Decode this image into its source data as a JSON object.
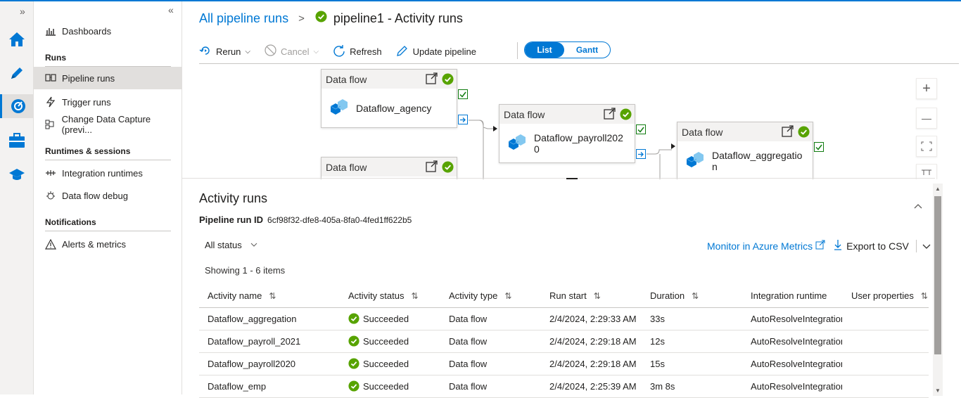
{
  "rail": {
    "expand": "»"
  },
  "nav": {
    "collapse": "«",
    "dashboards": "Dashboards",
    "runs_header": "Runs",
    "pipeline_runs": "Pipeline runs",
    "trigger_runs": "Trigger runs",
    "cdc": "Change Data Capture (previ...",
    "runtimes_header": "Runtimes & sessions",
    "integration_runtimes": "Integration runtimes",
    "dataflow_debug": "Data flow debug",
    "notifications_header": "Notifications",
    "alerts": "Alerts & metrics"
  },
  "breadcrumb": {
    "link": "All pipeline runs",
    "sep": ">",
    "title": "pipeline1 - Activity runs"
  },
  "toolbar": {
    "rerun": "Rerun",
    "cancel": "Cancel",
    "refresh": "Refresh",
    "update": "Update pipeline",
    "list": "List",
    "gantt": "Gantt"
  },
  "canvas": {
    "nodes": [
      {
        "type": "Data flow",
        "name": "Dataflow_agency"
      },
      {
        "type": "Data flow",
        "name": "Dataflow_payroll2020"
      },
      {
        "type": "Data flow",
        "name": "Dataflow_aggregation"
      },
      {
        "type": "Data flow",
        "name": ""
      }
    ],
    "zoom_in": "+",
    "zoom_out": "—"
  },
  "activity": {
    "title": "Activity runs",
    "run_id_label": "Pipeline run ID",
    "run_id": "6cf98f32-dfe8-405a-8fa0-4fed1ff622b5",
    "filter": "All status",
    "monitor": "Monitor in Azure Metrics",
    "export": "Export to CSV",
    "showing": "Showing 1 - 6 items",
    "columns": [
      "Activity name",
      "Activity status",
      "Activity type",
      "Run start",
      "Duration",
      "Integration runtime",
      "User properties"
    ],
    "rows": [
      [
        "Dataflow_aggregation",
        "Succeeded",
        "Data flow",
        "2/4/2024, 2:29:33 AM",
        "33s",
        "AutoResolveIntegrationRuntime"
      ],
      [
        "Dataflow_payroll_2021",
        "Succeeded",
        "Data flow",
        "2/4/2024, 2:29:18 AM",
        "12s",
        "AutoResolveIntegrationRuntime"
      ],
      [
        "Dataflow_payroll2020",
        "Succeeded",
        "Data flow",
        "2/4/2024, 2:29:18 AM",
        "15s",
        "AutoResolveIntegrationRuntime"
      ],
      [
        "Dataflow_emp",
        "Succeeded",
        "Data flow",
        "2/4/2024, 2:25:39 AM",
        "3m 8s",
        "AutoResolveIntegrationRuntime"
      ]
    ]
  },
  "colors": {
    "accent": "#0078d4",
    "success": "#57a300"
  }
}
